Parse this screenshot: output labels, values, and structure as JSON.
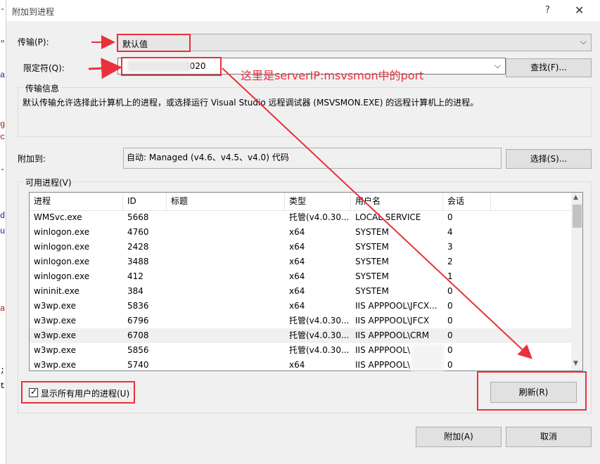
{
  "window": {
    "title": "附加到进程",
    "help_glyph": "?",
    "close_glyph": "✕"
  },
  "transport": {
    "label": "传输(P):",
    "value": "默认值"
  },
  "qualifier": {
    "label": "限定符(Q):",
    "value": "4020",
    "find_button": "查找(F)..."
  },
  "transport_info": {
    "title": "传输信息",
    "text": "默认传输允许选择此计算机上的进程，或选择运行 Visual Studio 远程调试器 (MSVSMON.EXE) 的远程计算机上的进程。"
  },
  "attach_to": {
    "label": "附加到:",
    "value": "自动: Managed (v4.6、v4.5、v4.0) 代码",
    "select_button": "选择(S)..."
  },
  "available": {
    "title": "可用进程(V)",
    "columns": [
      "进程",
      "ID",
      "标题",
      "类型",
      "用户名",
      "会话"
    ],
    "rows": [
      [
        "WMSvc.exe",
        "5668",
        "",
        "托管(v4.0.30...",
        "LOCAL SERVICE",
        "0"
      ],
      [
        "winlogon.exe",
        "4760",
        "",
        "x64",
        "SYSTEM",
        "4"
      ],
      [
        "winlogon.exe",
        "2428",
        "",
        "x64",
        "SYSTEM",
        "3"
      ],
      [
        "winlogon.exe",
        "3488",
        "",
        "x64",
        "SYSTEM",
        "2"
      ],
      [
        "winlogon.exe",
        "412",
        "",
        "x64",
        "SYSTEM",
        "1"
      ],
      [
        "wininit.exe",
        "384",
        "",
        "x64",
        "SYSTEM",
        "0"
      ],
      [
        "w3wp.exe",
        "5836",
        "",
        "x64",
        "IIS APPPOOL\\JFCX...",
        "0"
      ],
      [
        "w3wp.exe",
        "6796",
        "",
        "托管(v4.0.30...",
        "IIS APPPOOL\\JFCX",
        "0"
      ],
      [
        "w3wp.exe",
        "6708",
        "",
        "托管(v4.0.30...",
        "IIS APPPOOL\\CRM",
        "0"
      ],
      [
        "w3wp.exe",
        "5856",
        "",
        "托管(v4.0.30...",
        "IIS APPPOOL\\",
        "0"
      ],
      [
        "w3wp.exe",
        "5740",
        "",
        "x64",
        "IIS APPPOOL\\",
        "0"
      ]
    ],
    "show_all_users": {
      "label": "显示所有用户的进程(U)",
      "checked": true,
      "glyph": "✓"
    },
    "refresh_button": "刷新(R)"
  },
  "footer": {
    "attach_button": "附加(A)",
    "cancel_button": "取消"
  },
  "annotation": {
    "text": "这里是serverIP:msvsmon中的port",
    "color": "#e8313c"
  },
  "background_fragments": [
    "-",
    "\"",
    "a",
    "g",
    "c",
    "-",
    "d",
    "u",
    "a",
    ";",
    "tr"
  ]
}
